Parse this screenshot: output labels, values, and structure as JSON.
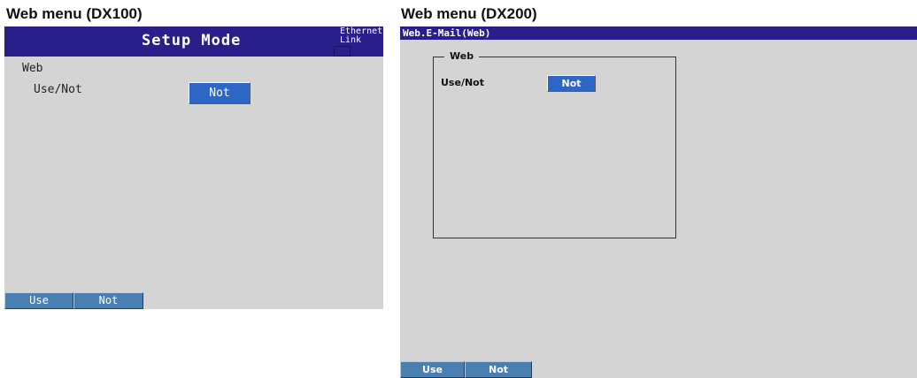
{
  "captions": {
    "dx100": "Web menu (DX100)",
    "dx200": "Web menu (DX200)"
  },
  "dx100": {
    "title": "Setup Mode",
    "ethernet_status_line1": "Ethernet",
    "ethernet_status_line2": "Link",
    "section_label": "Web",
    "field_label": "Use/Not",
    "field_value": "Not",
    "softkeys": [
      "Use",
      "Not"
    ]
  },
  "dx200": {
    "title": "Web.E-Mail(Web)",
    "group_label": "Web",
    "field_label": "Use/Not",
    "field_value": "Not",
    "softkeys": [
      "Use",
      "Not"
    ]
  },
  "colors": {
    "titlebar": "#2a1e8a",
    "screen_bg": "#d4d4d4",
    "selected_value_bg": "#2e66c6",
    "softkey_bg": "#4a7fb2"
  }
}
